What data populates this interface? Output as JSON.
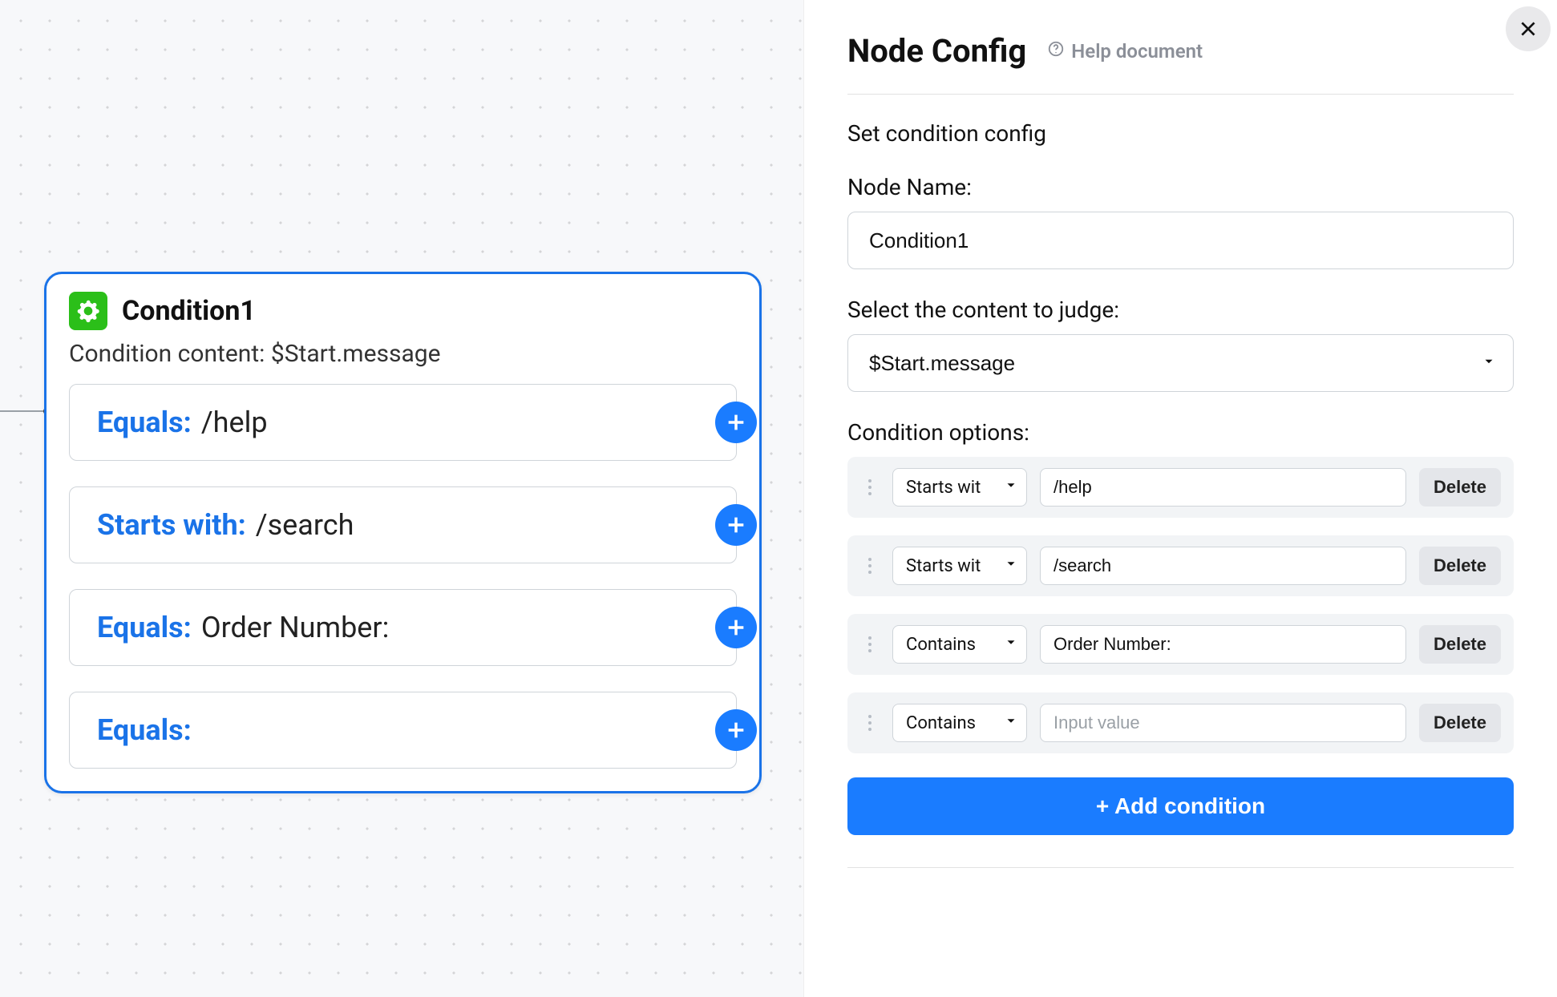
{
  "canvas": {
    "node": {
      "title": "Condition1",
      "subtitle": "Condition content: $Start.message",
      "branches": [
        {
          "op": "Equals:",
          "value": "/help"
        },
        {
          "op": "Starts with:",
          "value": "/search"
        },
        {
          "op": "Equals:",
          "value": "Order Number:"
        },
        {
          "op": "Equals:",
          "value": ""
        }
      ]
    }
  },
  "panel": {
    "title": "Node Config",
    "help_label": "Help document",
    "section_label": "Set condition config",
    "node_name_label": "Node Name:",
    "node_name_value": "Condition1",
    "content_label": "Select the content to judge:",
    "content_value": "$Start.message",
    "options_label": "Condition options:",
    "optionRows": [
      {
        "operator": "Starts wit",
        "value": "/help"
      },
      {
        "operator": "Starts wit",
        "value": "/search"
      },
      {
        "operator": "Contains",
        "value": "Order Number:"
      },
      {
        "operator": "Contains",
        "value": ""
      }
    ],
    "value_placeholder": "Input value",
    "delete_label": "Delete",
    "add_condition_label": "+ Add condition"
  }
}
